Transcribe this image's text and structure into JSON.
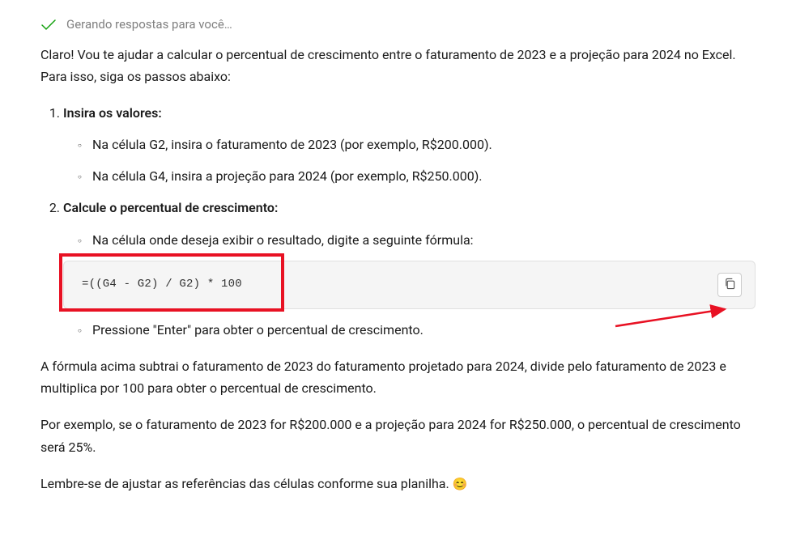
{
  "status": {
    "check": "✓",
    "text": "Gerando respostas para você…"
  },
  "intro": "Claro! Vou te ajudar a calcular o percentual de crescimento entre o faturamento de 2023 e a projeção para 2024 no Excel. Para isso, siga os passos abaixo:",
  "steps": [
    {
      "title": "Insira os valores:",
      "items": [
        "Na célula G2, insira o faturamento de 2023 (por exemplo, R$200.000).",
        "Na célula G4, insira a projeção para 2024 (por exemplo, R$250.000)."
      ]
    },
    {
      "title": "Calcule o percentual de crescimento:",
      "items": [
        "Na célula onde deseja exibir o resultado, digite a seguinte fórmula:"
      ],
      "code": "=((G4 - G2) / G2) * 100",
      "items_after": [
        "Pressione \"Enter\" para obter o percentual de crescimento."
      ]
    }
  ],
  "explain": "A fórmula acima subtrai o faturamento de 2023 do faturamento projetado para 2024, divide pelo faturamento de 2023 e multiplica por 100 para obter o percentual de crescimento.",
  "example": "Por exemplo, se o faturamento de 2023 for R$200.000 e a projeção para 2024 for R$250.000, o percentual de crescimento será 25%.",
  "reminder": "Lembre-se de ajustar as referências das células conforme sua planilha. ",
  "emoji": "😊"
}
